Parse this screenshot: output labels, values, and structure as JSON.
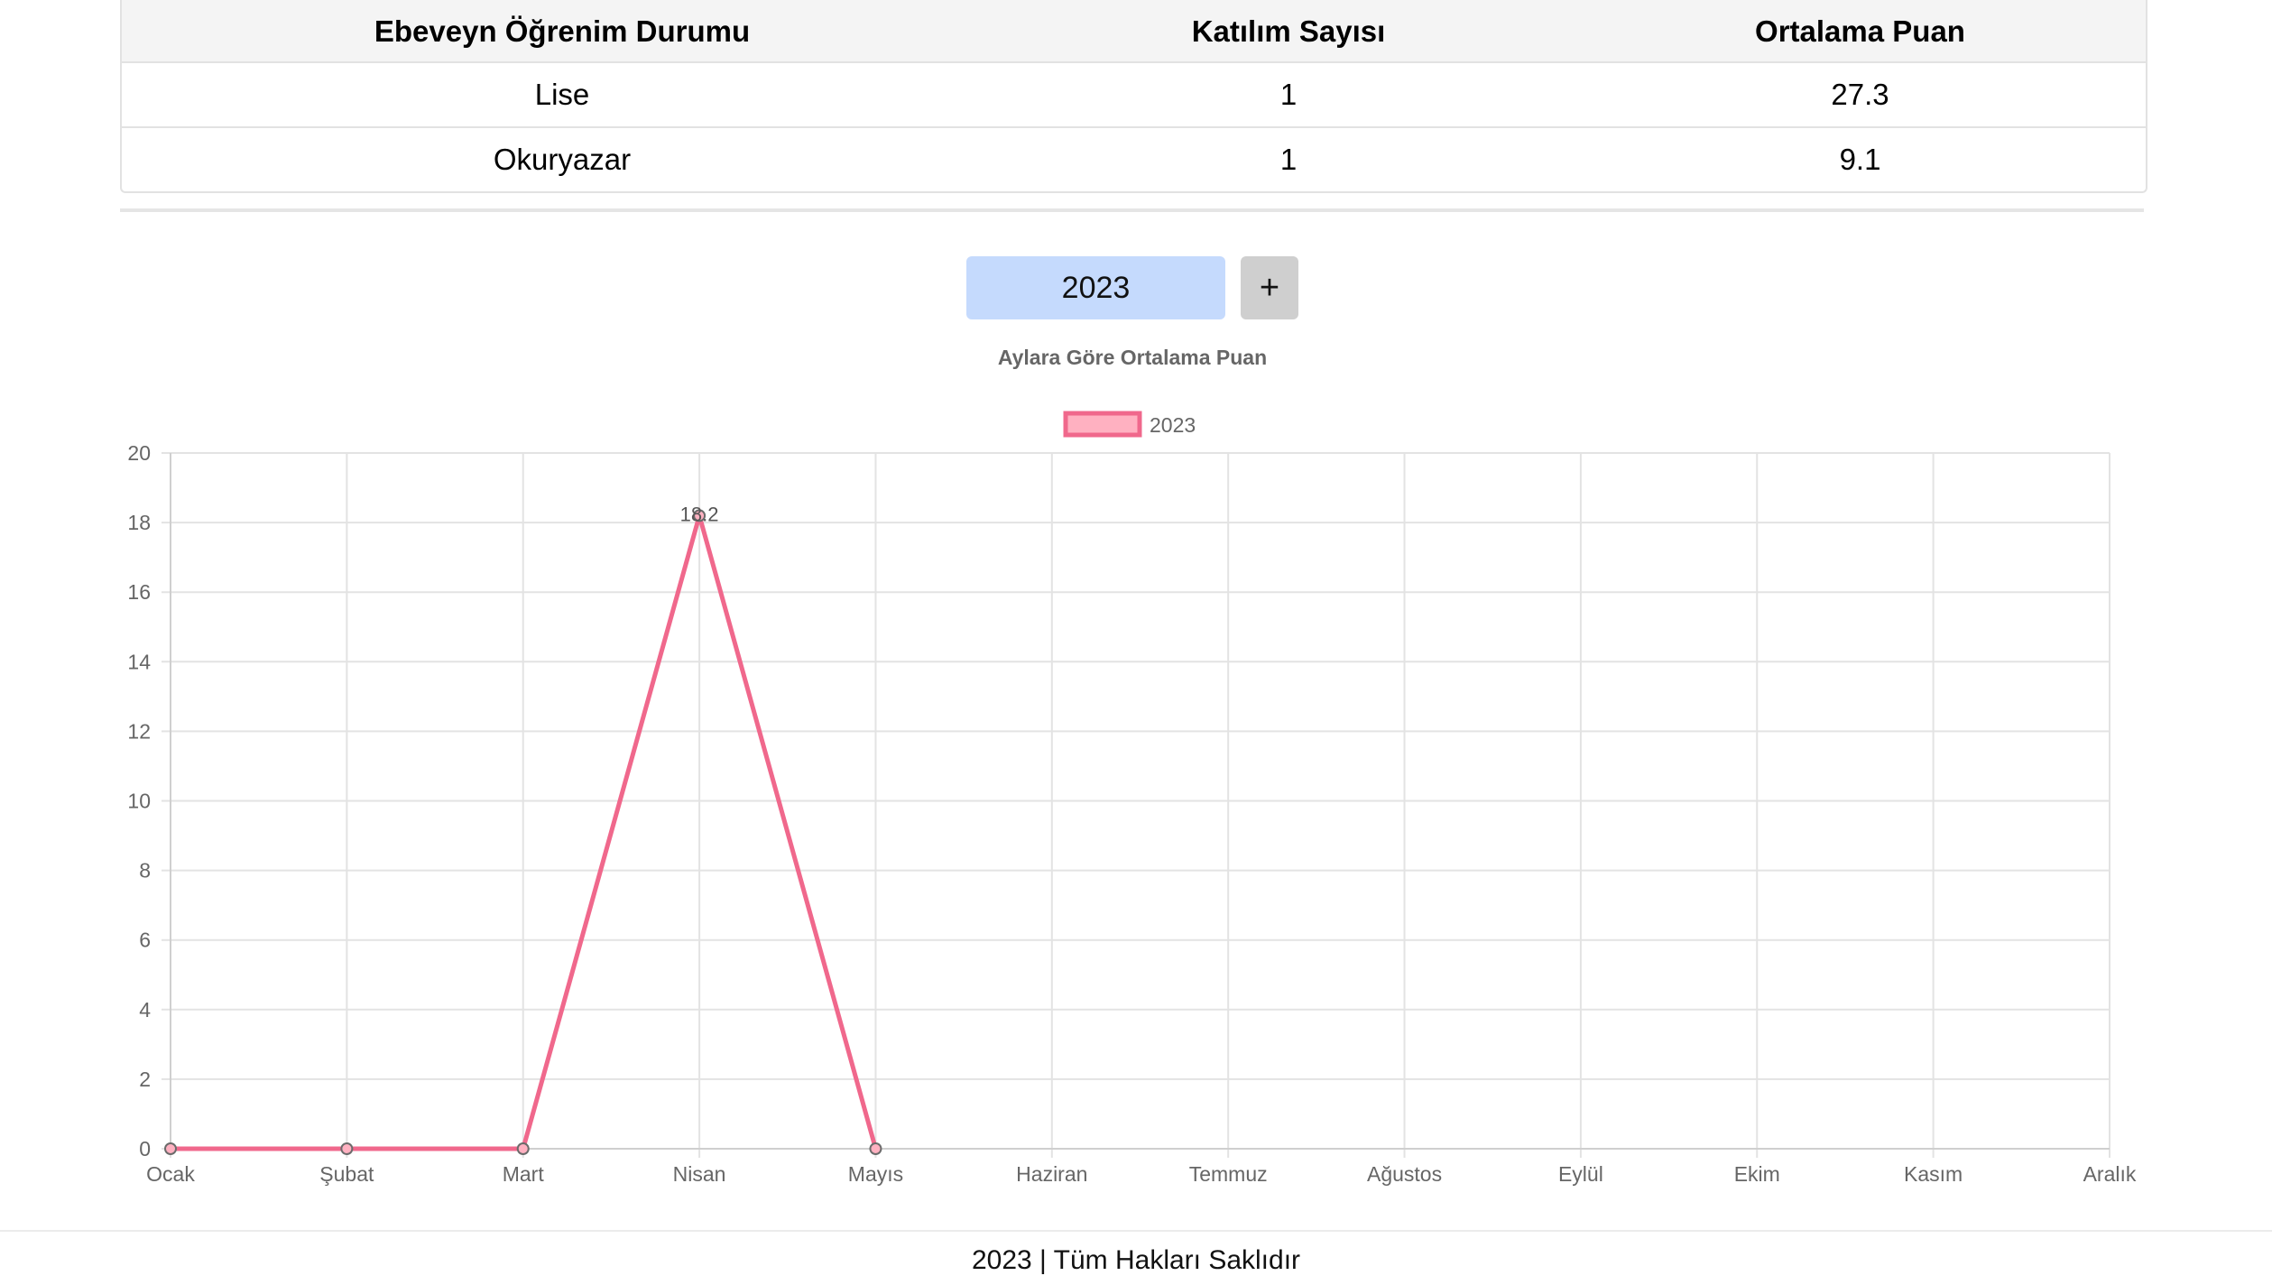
{
  "table": {
    "headers": [
      "Ebeveyn Öğrenim Durumu",
      "Katılım Sayısı",
      "Ortalama Puan"
    ],
    "rows": [
      [
        "Lise",
        "1",
        "27.3"
      ],
      [
        "Okuryazar",
        "1",
        "9.1"
      ]
    ]
  },
  "controls": {
    "year_value": "2023",
    "add_label": "+"
  },
  "chart_data": {
    "type": "line",
    "title": "Aylara Göre Ortalama Puan",
    "categories": [
      "Ocak",
      "Şubat",
      "Mart",
      "Nisan",
      "Mayıs",
      "Haziran",
      "Temmuz",
      "Ağustos",
      "Eylül",
      "Ekim",
      "Kasım",
      "Aralık"
    ],
    "series": [
      {
        "name": "2023",
        "values": [
          0,
          0,
          0,
          18.2,
          0,
          null,
          null,
          null,
          null,
          null,
          null,
          null
        ],
        "color": "#f0688c",
        "fill": "#ffb1c1"
      }
    ],
    "data_labels": [
      {
        "category": "Nisan",
        "text": "18.2"
      }
    ],
    "ylim": [
      0,
      20
    ],
    "yticks": [
      0,
      2,
      4,
      6,
      8,
      10,
      12,
      14,
      16,
      18,
      20
    ],
    "grid": true,
    "legend": "top"
  },
  "footer": {
    "text": "2023 | Tüm Hakları Saklıdır"
  }
}
